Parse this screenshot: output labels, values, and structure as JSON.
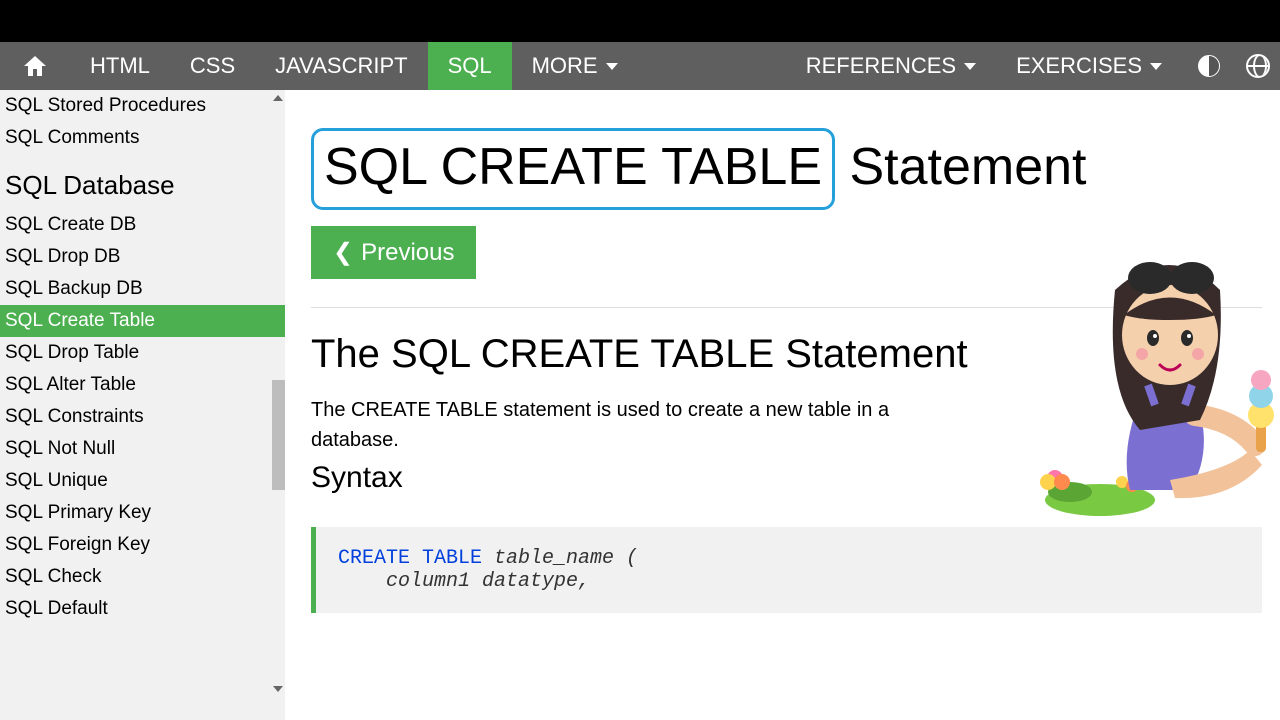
{
  "topnav": {
    "left": [
      "HTML",
      "CSS",
      "JAVASCRIPT",
      "SQL",
      "MORE"
    ],
    "active": "SQL",
    "right": [
      "REFERENCES",
      "EXERCISES"
    ]
  },
  "sidebar": {
    "top_items": [
      "SQL Stored Procedures",
      "SQL Comments"
    ],
    "section_title": "SQL Database",
    "items": [
      "SQL Create DB",
      "SQL Drop DB",
      "SQL Backup DB",
      "SQL Create Table",
      "SQL Drop Table",
      "SQL Alter Table",
      "SQL Constraints",
      "SQL Not Null",
      "SQL Unique",
      "SQL Primary Key",
      "SQL Foreign Key",
      "SQL Check",
      "SQL Default"
    ],
    "active": "SQL Create Table"
  },
  "page": {
    "title_highlighted": "SQL CREATE TABLE",
    "title_rest": " Statement",
    "prev_label": "Previous",
    "section_heading": "The SQL CREATE TABLE Statement",
    "paragraph": "The CREATE TABLE statement is used to create a new table in a database.",
    "syntax_heading": "Syntax",
    "code": {
      "kw": "CREATE TABLE",
      "line1_rest": " table_name (",
      "line2": "    column1 datatype,"
    }
  }
}
